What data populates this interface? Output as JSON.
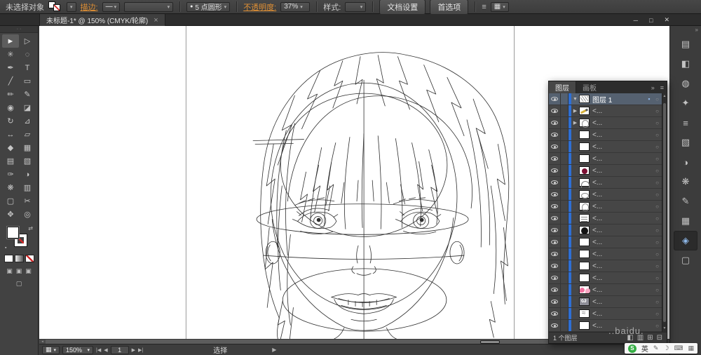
{
  "ui": {
    "caret": "▾",
    "head_dots": "· ·",
    "collapse_right": "»",
    "panel_menu": "≡",
    "swap": "⇄",
    "default_swatch": "▪",
    "scroll_left": "◂",
    "scroll_right": "▸",
    "scroll_up": "▲",
    "scroll_down": "▼"
  },
  "control_bar": {
    "no_selection": "未选择对象",
    "stroke_label": "描边:",
    "stroke_dash": "—",
    "brush_dot": "●",
    "brush_name": "5 点圆形",
    "opacity_label": "不透明度:",
    "opacity_value": "37%",
    "style_label": "样式:",
    "doc_setup": "文档设置",
    "preferences": "首选项",
    "menu_glyph": "≡",
    "workspace_glyph": "▦"
  },
  "tab_bar": {
    "doc_title": "未标题-1* @ 150% (CMYK/轮廓)",
    "tab_close": "×",
    "win_min": "─",
    "win_max": "□",
    "win_close": "✕"
  },
  "toolbar": {
    "tools": [
      {
        "name": "selection-tool",
        "glyph": "►",
        "active": true
      },
      {
        "name": "direct-selection-tool",
        "glyph": "▷"
      },
      {
        "name": "magic-wand-tool",
        "glyph": "✳"
      },
      {
        "name": "lasso-tool",
        "glyph": "◌"
      },
      {
        "name": "pen-tool",
        "glyph": "✒"
      },
      {
        "name": "type-tool",
        "glyph": "T"
      },
      {
        "name": "line-segment-tool",
        "glyph": "╱"
      },
      {
        "name": "rectangle-tool",
        "glyph": "▭"
      },
      {
        "name": "paintbrush-tool",
        "glyph": "✏"
      },
      {
        "name": "pencil-tool",
        "glyph": "✎"
      },
      {
        "name": "blob-brush-tool",
        "glyph": "◉"
      },
      {
        "name": "eraser-tool",
        "glyph": "◪"
      },
      {
        "name": "rotate-tool",
        "glyph": "↻"
      },
      {
        "name": "scale-tool",
        "glyph": "⊿"
      },
      {
        "name": "width-tool",
        "glyph": "↔"
      },
      {
        "name": "free-transform-tool",
        "glyph": "▱"
      },
      {
        "name": "shape-builder-tool",
        "glyph": "◆"
      },
      {
        "name": "perspective-grid-tool",
        "glyph": "▦"
      },
      {
        "name": "mesh-tool",
        "glyph": "▤"
      },
      {
        "name": "gradient-tool",
        "glyph": "▧"
      },
      {
        "name": "eyedropper-tool",
        "glyph": "✑"
      },
      {
        "name": "blend-tool",
        "glyph": "◑"
      },
      {
        "name": "symbol-sprayer-tool",
        "glyph": "❋"
      },
      {
        "name": "column-graph-tool",
        "glyph": "▥"
      },
      {
        "name": "artboard-tool",
        "glyph": "▢"
      },
      {
        "name": "slice-tool",
        "glyph": "✂"
      },
      {
        "name": "hand-tool",
        "glyph": "✥"
      },
      {
        "name": "zoom-tool",
        "glyph": "◎"
      }
    ]
  },
  "dock": {
    "icons": [
      {
        "name": "color-panel-icon",
        "glyph": "▤"
      },
      {
        "name": "color-guide-icon",
        "glyph": "◧"
      },
      {
        "name": "appearance-icon",
        "glyph": "◍"
      },
      {
        "name": "graphic-styles-icon",
        "glyph": "✦"
      },
      {
        "name": "stroke-panel-icon",
        "glyph": "≡"
      },
      {
        "name": "gradient-panel-icon",
        "glyph": "▧"
      },
      {
        "name": "transparency-icon",
        "glyph": "◑"
      },
      {
        "name": "symbols-panel-icon",
        "glyph": "❋"
      },
      {
        "name": "brushes-panel-icon",
        "glyph": "✎"
      },
      {
        "name": "swatches-panel-icon",
        "glyph": "▦"
      },
      {
        "name": "layers-panel-icon",
        "glyph": "◈",
        "active": true
      },
      {
        "name": "artboards-panel-icon",
        "glyph": "▢"
      }
    ]
  },
  "layers_panel": {
    "tabs": [
      {
        "name": "tab-layers",
        "label": "图层",
        "active": true
      },
      {
        "name": "tab-artboards",
        "label": "画板"
      }
    ],
    "target_glyph": "○",
    "selected_glyph": "▪",
    "rows": [
      {
        "name": "layer-row-1",
        "label": "图层 1",
        "thumb": "sketch",
        "expand": "▼",
        "selected": true
      },
      {
        "name": "layer-row-2",
        "label": "<...",
        "thumb": "pencil",
        "expand": "▶"
      },
      {
        "name": "layer-row-3",
        "label": "<...",
        "thumb": "face",
        "expand": "▶"
      },
      {
        "name": "layer-row-4",
        "label": "<...",
        "thumb": "white",
        "expand": ""
      },
      {
        "name": "layer-row-5",
        "label": "<...",
        "thumb": "white",
        "expand": ""
      },
      {
        "name": "layer-row-6",
        "label": "<...",
        "thumb": "white",
        "expand": ""
      },
      {
        "name": "layer-row-7",
        "label": "<...",
        "thumb": "maroon",
        "expand": ""
      },
      {
        "name": "layer-row-8",
        "label": "<...",
        "thumb": "arc",
        "expand": ""
      },
      {
        "name": "layer-row-9",
        "label": "<...",
        "thumb": "oval",
        "expand": ""
      },
      {
        "name": "layer-row-10",
        "label": "<...",
        "thumb": "face",
        "expand": ""
      },
      {
        "name": "layer-row-11",
        "label": "<...",
        "thumb": "lines",
        "expand": ""
      },
      {
        "name": "layer-row-12",
        "label": "<...",
        "thumb": "black",
        "expand": ""
      },
      {
        "name": "layer-row-13",
        "label": "<...",
        "thumb": "white",
        "expand": ""
      },
      {
        "name": "layer-row-14",
        "label": "<...",
        "thumb": "white",
        "expand": ""
      },
      {
        "name": "layer-row-15",
        "label": "<...",
        "thumb": "white",
        "expand": ""
      },
      {
        "name": "layer-row-16",
        "label": "<...",
        "thumb": "white",
        "expand": ""
      },
      {
        "name": "layer-row-17",
        "label": "<...",
        "thumb": "blush",
        "expand": ""
      },
      {
        "name": "layer-row-18",
        "label": "<...",
        "thumb": "lips",
        "expand": ""
      },
      {
        "name": "layer-row-19",
        "label": "<...",
        "thumb": "squiggle",
        "expand": ""
      },
      {
        "name": "layer-row-20",
        "label": "<...",
        "thumb": "white",
        "expand": ""
      }
    ],
    "footer_label": "1 个图层",
    "footer_icons": [
      {
        "name": "make-clipping-mask-icon",
        "glyph": "◧"
      },
      {
        "name": "new-sublayer-icon",
        "glyph": "▥"
      },
      {
        "name": "new-layer-icon",
        "glyph": "⊞"
      },
      {
        "name": "delete-layer-icon",
        "glyph": "⊟"
      }
    ]
  },
  "status_bar": {
    "view_glyph": "▦",
    "zoom": "150%",
    "nav_first": "|◀",
    "nav_prev": "◀",
    "artboard": "1",
    "nav_next": "▶",
    "nav_last": "▶|",
    "status": "选择",
    "popup": "▶"
  },
  "ime": {
    "logo": "S",
    "lang": "英",
    "icons": [
      {
        "name": "ime-pen-icon",
        "glyph": "✎"
      },
      {
        "name": "ime-night-icon",
        "glyph": "☽"
      },
      {
        "name": "ime-keyboard-icon",
        "glyph": "⌨"
      },
      {
        "name": "ime-toolbox-icon",
        "glyph": "▦"
      }
    ]
  },
  "watermark": {
    "text": "..baidu."
  }
}
